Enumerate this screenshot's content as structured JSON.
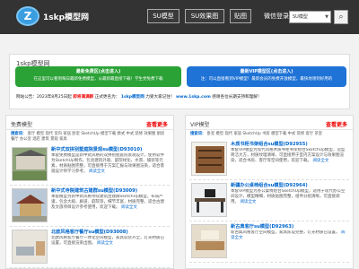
{
  "header": {
    "logo_mark": "Z",
    "logo_text": "1skp模型网",
    "nav": [
      "SU模型",
      "SU效果图",
      "贴图"
    ],
    "login": "微信登录",
    "search_select": "SU模型",
    "colors": {
      "bg": "#333333"
    }
  },
  "info": {
    "title": "1skp模型网",
    "green_badge": {
      "line1": "最新免费区(点击进入)",
      "line2": "在这里可以看到每日最新免费模型，从最新最直接下载！学生党免费下载"
    },
    "blue_badge": {
      "line1": "最新VIP模型区(点击进入)",
      "line2": "注：可以直接看到VIP模型！最新会员的免费开放模型，最快地领到好用的"
    },
    "marquee": {
      "date_text": "网站公告：2023年8月25日起",
      "red_text": "即将满满群",
      "mid_text": "正式更名为：",
      "brand": "1skp模型网",
      "tail_text": "力受大家记住！",
      "url": "www.1skp.com",
      "end_text": "感谢各位长期支持和理解！"
    }
  },
  "free": {
    "title": "免费模型",
    "more": "查看更多",
    "tag_label": "搜索词：",
    "tags": "客厅 模型 现代 室内 家居 卧室 SketchUp 模型下载 欧式 中式 装修 效果图 厨房 餐厅 办公室 酒店 建筑 景观 家具",
    "entries": [
      {
        "title": "新中式双拼别墅庭院景观su模型(D93010)",
        "desc": "本套免费模型是新中式风格的双拼别墅庭院景观设计，使用软件为SketchUp制作，包含建筑外观、庭院绿化、水景、铺装等元素，材质贴图完整，可直接用于方案汇报与效果图渲染，适合景观设计师学习参考。",
        "read_more": "阅读全文"
      },
      {
        "title": "新中式寺院建筑古建群su模型(D93009)",
        "desc": "本套模型为新中式风格寺院建筑古建群SketchUp模型，布局严谨，包含大殿、廊道、庭院等，细节丰富，材质完整，适合古建及文旅项目设计参考使用，欢迎下载。",
        "read_more": "阅读全文"
      },
      {
        "title": "北欧风格客厅餐厅su模型(D93008)",
        "desc": "北欧风格客厅餐厅一体化空间模型，家具软装齐全，灯光材质已设置，可直接渲染出图。",
        "read_more": "阅读全文"
      }
    ]
  },
  "vip": {
    "title": "VIP模型",
    "more": "查看更多",
    "tag_label": "搜索词：",
    "tags": "卧室 模型 现代 家居 SketchUp 书房 模型下载 中式 装修 客厅 茶室",
    "entries": [
      {
        "title": "木质书柜书架组合su模型(D92955)",
        "desc": "本套VIP模型为现代风格木质书柜书架组合SketchUp模型，造型简洁大方，材质纹理清晰，可直接用于室内方案设计与效果图渲染，适合书房、客厅等空间使用，欢迎下载。",
        "read_more": "阅读全文"
      },
      {
        "title": "新疆办公桌椅组合su模型(D92964)",
        "desc": "本套VIP模型为办公桌椅组合SketchUp模型，适用于现代办公空间设计，模型精细，材质贴图完整，组件分组清晰，可直接调用。",
        "read_more": "阅读全文"
      },
      {
        "title": "新古典客厅su模型(D92963)",
        "desc": "新古典风格客厅空间模型，家具陈设完整，灯光材质已设置。",
        "read_more": "阅读全文"
      }
    ]
  }
}
